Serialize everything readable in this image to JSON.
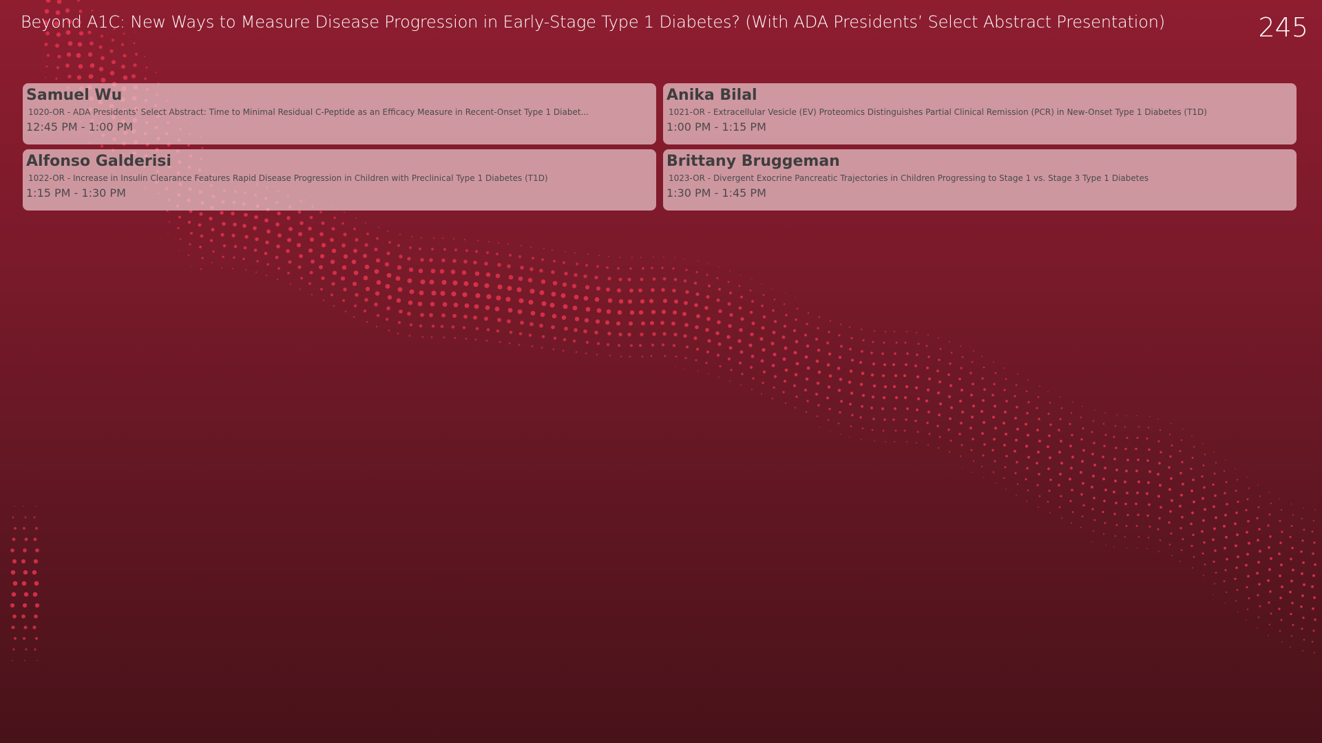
{
  "header": {
    "title": "Beyond A1C: New Ways to Measure Disease Progression in Early-Stage Type 1 Diabetes? (With ADA Presidents’ Select Abstract Presentation)",
    "room_number": "245"
  },
  "sessions": [
    {
      "speaker": "Samuel Wu",
      "abstract": "1020-OR - ADA Presidents' Select Abstract: Time to Minimal Residual C-Peptide as an Efficacy Measure in Recent-Onset Type 1 Diabet...",
      "time": "12:45 PM - 1:00 PM"
    },
    {
      "speaker": "Anika Bilal",
      "abstract": "1021-OR - Extracellular Vesicle (EV) Proteomics Distinguishes Partial Clinical Remission (PCR) in New-Onset Type 1 Diabetes (T1D)",
      "time": "1:00 PM - 1:15 PM"
    },
    {
      "speaker": "Alfonso Galderisi",
      "abstract": "1022-OR - Increase in Insulin Clearance Features Rapid Disease Progression in Children with Preclinical Type 1 Diabetes (T1D)",
      "time": "1:15 PM - 1:30 PM"
    },
    {
      "speaker": "Brittany Bruggeman",
      "abstract": "1023-OR - Divergent Exocrine Pancreatic Trajectories in Children Progressing to Stage 1 vs. Stage 3 Type 1 Diabetes",
      "time": "1:30 PM - 1:45 PM"
    }
  ],
  "colors": {
    "background_top": "#8e1d30",
    "background_bottom": "#481219",
    "dot_accent": "#e8344f",
    "card_fill": "#ebc8cd",
    "card_text": "#3e3e3e",
    "title_text": "#ffffff"
  }
}
